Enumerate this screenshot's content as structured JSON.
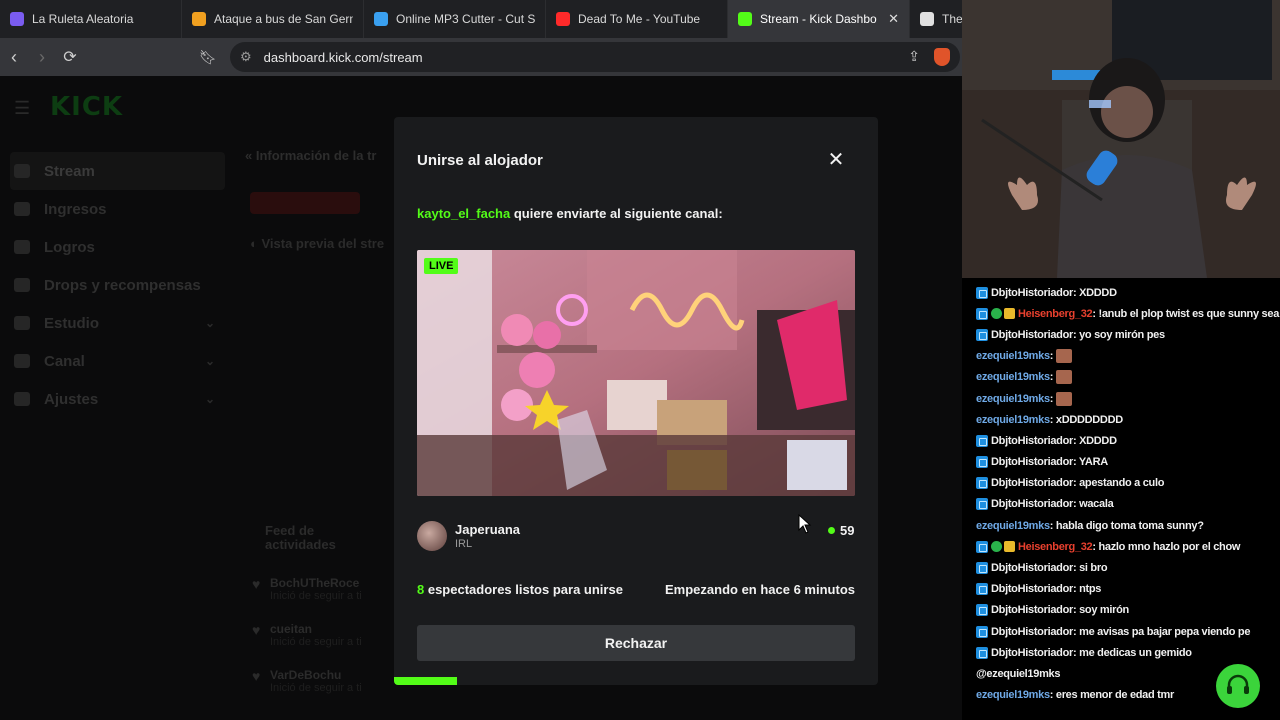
{
  "browser": {
    "tabs": [
      {
        "title": "La Ruleta Aleatoria",
        "color": "#7a5cf0",
        "icon": "wheel-icon"
      },
      {
        "title": "Ataque a bus de San Germ",
        "color": "#f0a020",
        "icon": "news-icon"
      },
      {
        "title": "Online MP3 Cutter - Cut S",
        "color": "#3aa0f0",
        "icon": "audio-icon"
      },
      {
        "title": "Dead To Me - YouTube",
        "color": "#ff2a2a",
        "icon": "youtube-icon"
      },
      {
        "title": "Stream - Kick Dashbo",
        "color": "#53fc18",
        "icon": "kick-icon",
        "active": true
      },
      {
        "title": "The b",
        "color": "#e0e0e0",
        "icon": "diamond-icon"
      }
    ],
    "close_label": "✕",
    "url": "dashboard.kick.com/stream"
  },
  "page": {
    "logo": "KICK",
    "sidebar": [
      {
        "label": "Stream",
        "active": true
      },
      {
        "label": "Ingresos"
      },
      {
        "label": "Logros"
      },
      {
        "label": "Drops y recompensas"
      },
      {
        "label": "Estudio",
        "chevron": true
      },
      {
        "label": "Canal",
        "chevron": true
      },
      {
        "label": "Ajustes",
        "chevron": true
      }
    ],
    "info_header": "Información de la tr",
    "preview_header": "Vista previa del stre",
    "feed_title": "Feed de actividades",
    "feed": [
      {
        "name": "BochUTheRoce",
        "sub": "Inició de seguir a ti"
      },
      {
        "name": "cueitan",
        "sub": "Inició de seguir a ti"
      },
      {
        "name": "VarDeBochu",
        "sub": "Inició de seguir a ti"
      }
    ]
  },
  "modal": {
    "title": "Unirse al alojador",
    "sender": "kayto_el_facha",
    "message": " quiere enviarte al siguiente canal:",
    "live_badge": "LIVE",
    "channel_name": "Japeruana",
    "channel_category": "IRL",
    "viewer_count": "59",
    "ready_count": "8",
    "ready_text": " espectadores listos para unirse",
    "started_text": "Empezando en hace 6 minutos",
    "reject_label": "Rechazar",
    "countdown_fraction": 0.13
  },
  "chat": {
    "messages": [
      {
        "badges": [
          "mod"
        ],
        "user": "DbjtoHistoriador",
        "color": "white",
        "text": ": XDDDD"
      },
      {
        "badges": [
          "mod",
          "green",
          "gold"
        ],
        "user": "Heisenberg_32",
        "color": "red",
        "text": ": !anub el plop twist es que sunny sea la flaca daaa"
      },
      {
        "badges": [
          "mod"
        ],
        "user": "DbjtoHistoriador",
        "color": "white",
        "text": ": yo soy mirón pes"
      },
      {
        "badges": [],
        "user": "ezequiel19mks",
        "color": "blue",
        "text": " :",
        "emote": true
      },
      {
        "badges": [],
        "user": "ezequiel19mks",
        "color": "blue",
        "text": " :",
        "emote": true
      },
      {
        "badges": [],
        "user": "ezequiel19mks",
        "color": "blue",
        "text": " :",
        "emote": true
      },
      {
        "badges": [],
        "user": "ezequiel19mks",
        "color": "blue",
        "text": " : xDDDDDDDD"
      },
      {
        "badges": [
          "mod"
        ],
        "user": "DbjtoHistoriador",
        "color": "white",
        "text": ": XDDDD"
      },
      {
        "badges": [
          "mod"
        ],
        "user": "DbjtoHistoriador",
        "color": "white",
        "text": ": YARA"
      },
      {
        "badges": [
          "mod"
        ],
        "user": "DbjtoHistoriador",
        "color": "white",
        "text": ": apestando a culo"
      },
      {
        "badges": [
          "mod"
        ],
        "user": "DbjtoHistoriador",
        "color": "white",
        "text": ": wacala"
      },
      {
        "badges": [],
        "user": "ezequiel19mks",
        "color": "blue",
        "text": " : habla digo toma toma sunny?"
      },
      {
        "badges": [
          "mod",
          "green",
          "gold"
        ],
        "user": "Heisenberg_32",
        "color": "red",
        "text": ": hazlo mno hazlo por el chow"
      },
      {
        "badges": [
          "mod"
        ],
        "user": "DbjtoHistoriador",
        "color": "white",
        "text": ": si bro"
      },
      {
        "badges": [
          "mod"
        ],
        "user": "DbjtoHistoriador",
        "color": "white",
        "text": ": ntps"
      },
      {
        "badges": [
          "mod"
        ],
        "user": "DbjtoHistoriador",
        "color": "white",
        "text": ": soy mirón"
      },
      {
        "badges": [
          "mod"
        ],
        "user": "DbjtoHistoriador",
        "color": "white",
        "text": ": me avisas pa bajar pepa viendo pe"
      },
      {
        "badges": [
          "mod"
        ],
        "user": "DbjtoHistoriador",
        "color": "white",
        "text": ": me dedicas un gemido"
      },
      {
        "badges": [],
        "user": "@ezequiel19mks",
        "color": "plain",
        "text": ""
      },
      {
        "badges": [],
        "user": "ezequiel19mks",
        "color": "blue",
        "text": " : eres menor de edad tmr"
      }
    ]
  },
  "colors": {
    "accent": "#53fc18",
    "modal_bg": "#1a1b1d",
    "button_bg": "#36383b"
  }
}
